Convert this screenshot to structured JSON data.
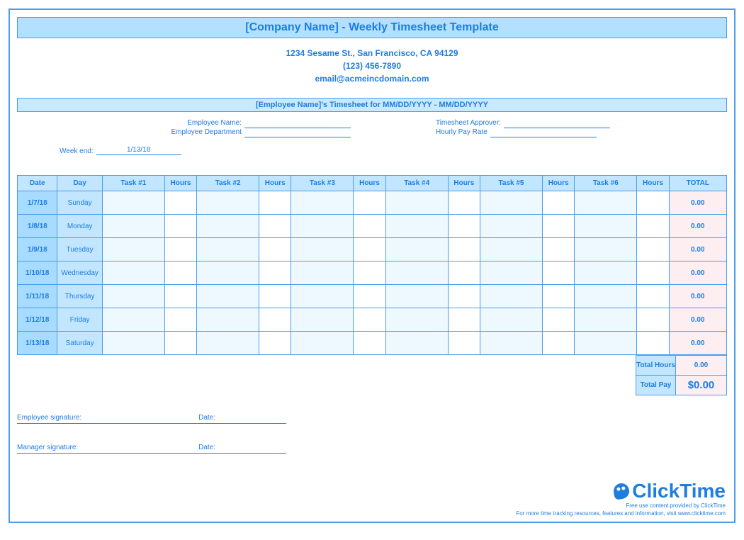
{
  "title": "[Company Name] - Weekly Timesheet Template",
  "contact": {
    "address": "1234 Sesame St.,  San Francisco, CA 94129",
    "phone": "(123) 456-7890",
    "email": "email@acmeincdomain.com"
  },
  "sub_title": "[Employee Name]'s Timesheet for MM/DD/YYYY - MM/DD/YYYY",
  "info": {
    "emp_name_lbl": "Employee Name:",
    "emp_dept_lbl": "Employee Department",
    "approver_lbl": "Timesheet Approver:",
    "payrate_lbl": "Hourly Pay Rate",
    "weekend_lbl": "Week end:",
    "weekend_val": "1/13/18"
  },
  "headers": [
    "Date",
    "Day",
    "Task #1",
    "Hours",
    "Task #2",
    "Hours",
    "Task #3",
    "Hours",
    "Task #4",
    "Hours",
    "Task #5",
    "Hours",
    "Task #6",
    "Hours",
    "TOTAL"
  ],
  "rows": [
    {
      "date": "1/7/18",
      "day": "Sunday",
      "total": "0.00"
    },
    {
      "date": "1/8/18",
      "day": "Monday",
      "total": "0.00"
    },
    {
      "date": "1/9/18",
      "day": "Tuesday",
      "total": "0.00"
    },
    {
      "date": "1/10/18",
      "day": "Wednesday",
      "total": "0.00"
    },
    {
      "date": "1/11/18",
      "day": "Thursday",
      "total": "0.00"
    },
    {
      "date": "1/12/18",
      "day": "Friday",
      "total": "0.00"
    },
    {
      "date": "1/13/18",
      "day": "Saturday",
      "total": "0.00"
    }
  ],
  "summary": {
    "total_hours_lbl": "Total Hours",
    "total_hours_val": "0.00",
    "total_pay_lbl": "Total Pay",
    "total_pay_val": "$0.00"
  },
  "sig": {
    "emp_sig": "Employee signature:",
    "mgr_sig": "Manager signature:",
    "date": "Date:"
  },
  "footer": {
    "brand": "ClickTime",
    "l1": "Free use content provided by ClickTime",
    "l2": "For more time tracking resources, features and information, visit www.clicktime.com"
  }
}
